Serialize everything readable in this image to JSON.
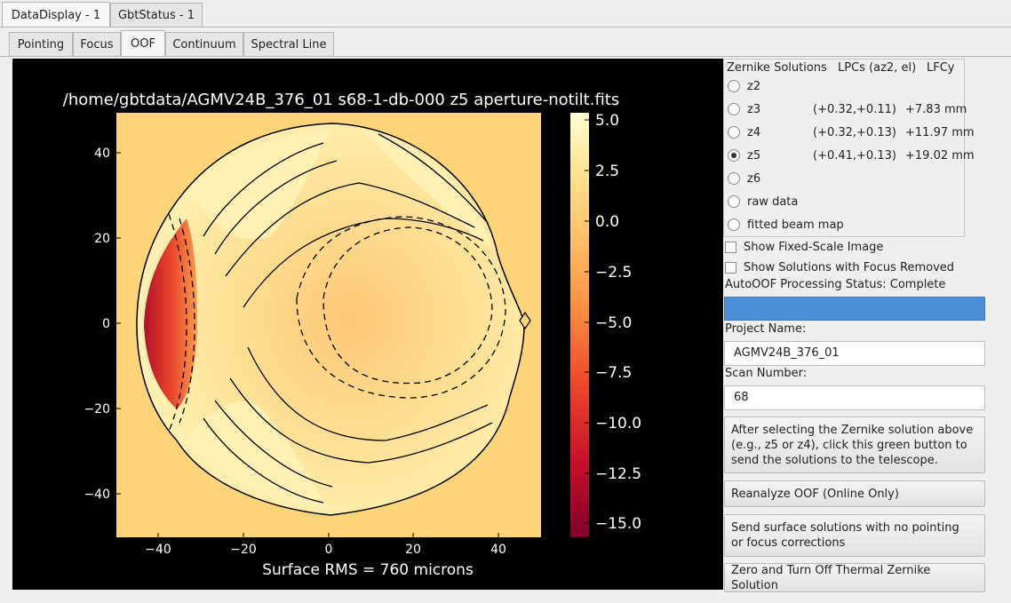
{
  "window_tabs": [
    {
      "label": "DataDisplay - 1",
      "active": true
    },
    {
      "label": "GbtStatus - 1",
      "active": false
    }
  ],
  "sub_tabs": [
    {
      "label": "Pointing",
      "active": false
    },
    {
      "label": "Focus",
      "active": false
    },
    {
      "label": "OOF",
      "active": true
    },
    {
      "label": "Continuum",
      "active": false
    },
    {
      "label": "Spectral Line",
      "active": false
    }
  ],
  "plot": {
    "title": "/home/gbtdata/AGMV24B_376_01 s68-1-db-000 z5 aperture-notilt.fits",
    "caption": "Surface RMS = 760 microns",
    "x_ticks": [
      "−40",
      "−20",
      "0",
      "20",
      "40"
    ],
    "y_ticks": [
      "40",
      "20",
      "0",
      "−20",
      "−40"
    ],
    "colorbar_ticks": [
      "5.0",
      "2.5",
      "0.0",
      "−2.5",
      "−5.0",
      "−7.5",
      "−10.0",
      "−12.5",
      "−15.0"
    ],
    "colors": {
      "background": "#000000",
      "high": "#fffccc",
      "mid": "#fed47a",
      "low": "#8b0028"
    }
  },
  "zernike": {
    "header_solutions": "Zernike Solutions",
    "header_lpcs": "LPCs (az2, el)",
    "header_lfcy": "LFCy",
    "options": [
      {
        "label": "z2",
        "lpc": "",
        "lfc": "",
        "checked": false
      },
      {
        "label": "z3",
        "lpc": "(+0.32,+0.11)",
        "lfc": "+7.83 mm",
        "checked": false
      },
      {
        "label": "z4",
        "lpc": "(+0.32,+0.13)",
        "lfc": "+11.97 mm",
        "checked": false
      },
      {
        "label": "z5",
        "lpc": "(+0.41,+0.13)",
        "lfc": "+19.02 mm",
        "checked": true
      },
      {
        "label": "z6",
        "lpc": "",
        "lfc": "",
        "checked": false
      },
      {
        "label": "raw data",
        "lpc": "",
        "lfc": "",
        "checked": false
      },
      {
        "label": "fitted beam map",
        "lpc": "",
        "lfc": "",
        "checked": false
      }
    ]
  },
  "options": {
    "fixed_scale": "Show Fixed-Scale Image",
    "focus_removed": "Show Solutions with Focus Removed"
  },
  "status": {
    "label": "AutoOOF Processing Status: Complete",
    "progress": 1.0,
    "progress_color": "#4a90d9"
  },
  "project": {
    "label": "Project Name:",
    "value": "AGMV24B_376_01"
  },
  "scan": {
    "label": "Scan Number:",
    "value": "68"
  },
  "buttons": {
    "send_green": "After selecting the Zernike solution above\n (e.g., z5 or z4), click this green button to\nsend the solutions to the telescope.",
    "reanalyze": "Reanalyze OOF (Online Only)",
    "send_surface": "Send surface solutions with no pointing\n or focus corrections",
    "zero_thermal": "Zero and Turn Off Thermal Zernike Solution"
  }
}
